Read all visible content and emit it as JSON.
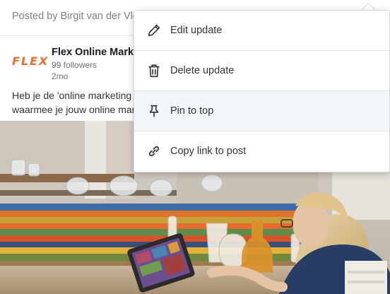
{
  "post": {
    "posted_by": "Posted by Birgit van der Vleuten",
    "company": {
      "logo_text": "FLEX",
      "name": "Flex Online Marketing",
      "followers": "99 followers",
      "time": "2mo"
    },
    "text_line1": "Heb je de 'online marketing",
    "text_line2": "waarmee je jouw online mar"
  },
  "menu": {
    "items": [
      {
        "label": "Edit update",
        "icon": "pencil-icon"
      },
      {
        "label": "Delete update",
        "icon": "trash-icon"
      },
      {
        "label": "Pin to top",
        "icon": "pin-icon"
      },
      {
        "label": "Copy link to post",
        "icon": "link-icon"
      }
    ]
  },
  "colors": {
    "brand_orange": "#e8702a",
    "menu_hover": "#f3f6f8",
    "text_primary": "#333333",
    "text_muted": "#808080"
  }
}
